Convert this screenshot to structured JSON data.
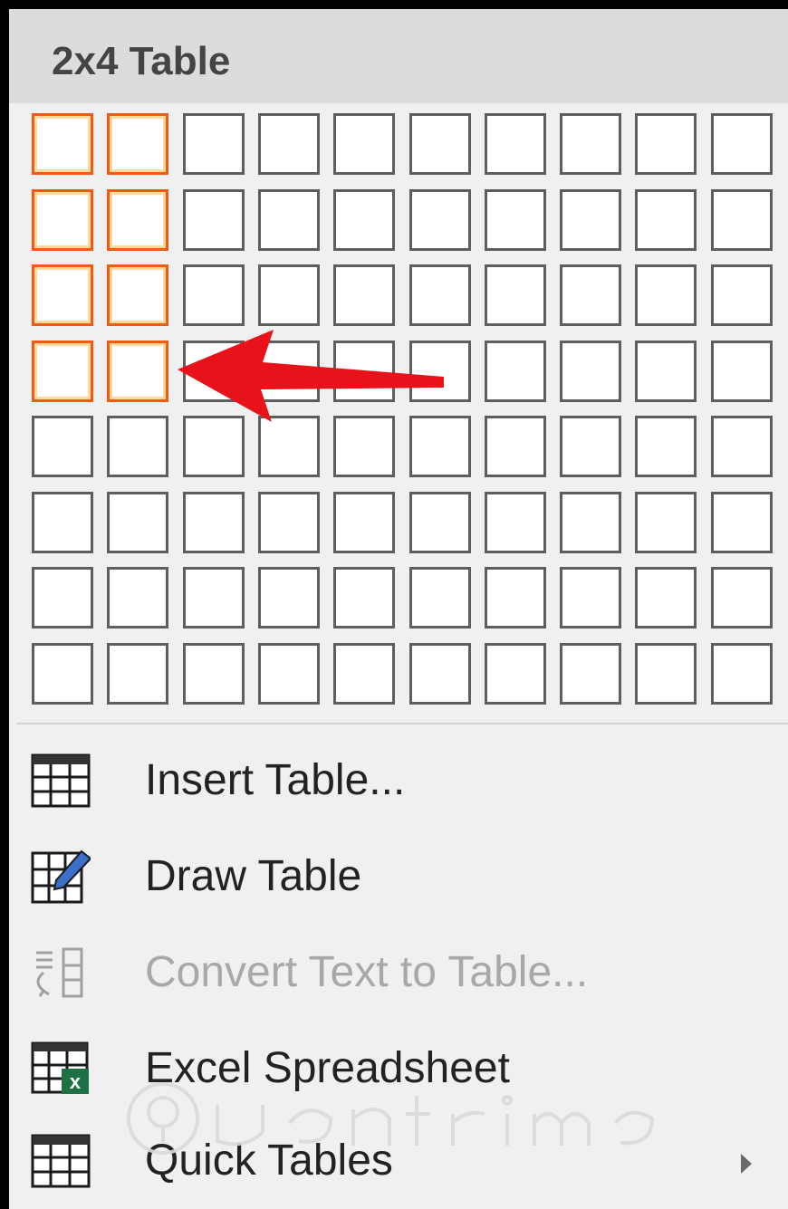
{
  "header": {
    "title": "2x4 Table"
  },
  "grid": {
    "columns": 10,
    "rows": 8,
    "selected_columns": 2,
    "selected_rows": 4
  },
  "menu": {
    "items": [
      {
        "label": "Insert Table...",
        "icon": "insert-table-icon",
        "enabled": true,
        "has_submenu": false
      },
      {
        "label": "Draw Table",
        "icon": "draw-table-icon",
        "enabled": true,
        "has_submenu": false
      },
      {
        "label": "Convert Text to Table...",
        "icon": "convert-text-to-table-icon",
        "enabled": false,
        "has_submenu": false
      },
      {
        "label": "Excel Spreadsheet",
        "icon": "excel-spreadsheet-icon",
        "enabled": true,
        "has_submenu": false
      },
      {
        "label": "Quick Tables",
        "icon": "quick-tables-icon",
        "enabled": true,
        "has_submenu": true
      }
    ]
  },
  "colors": {
    "selection_border": "#f05a12",
    "selection_glow": "#ffd89a",
    "annotation_arrow": "#e8121a",
    "excel_green": "#1e7145"
  }
}
